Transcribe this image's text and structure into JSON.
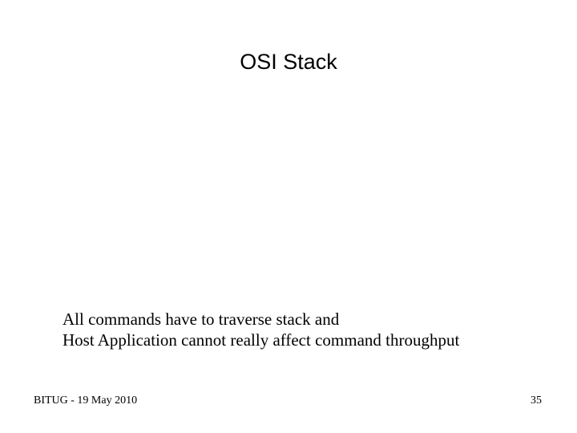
{
  "title": "OSI Stack",
  "body_line1": "All commands have to traverse stack and",
  "body_line2": "Host Application cannot really affect command throughput",
  "footer": {
    "left": "BITUG - 19 May 2010",
    "right": "35"
  }
}
